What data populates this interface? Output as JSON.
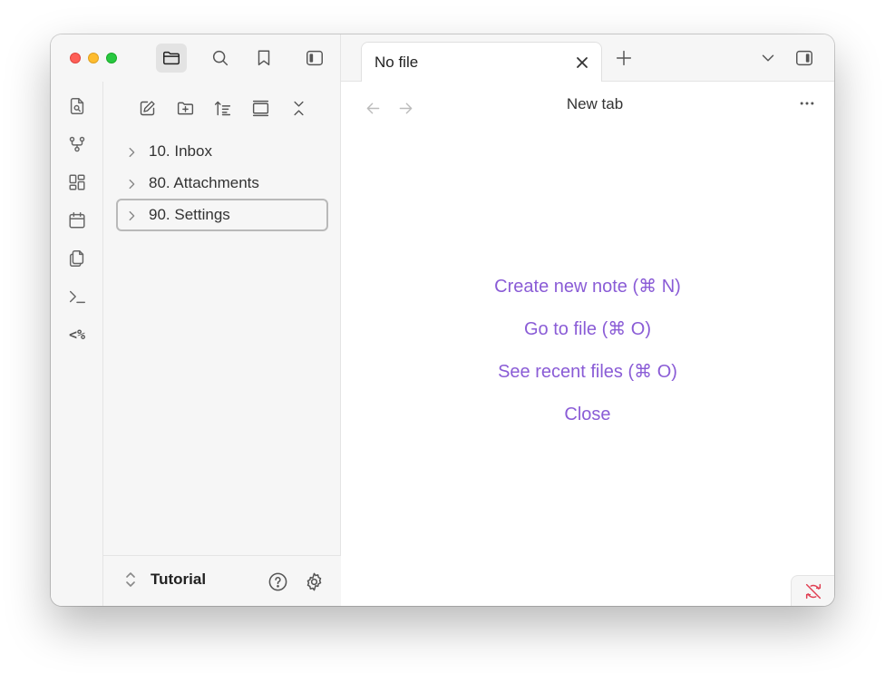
{
  "colors": {
    "accent": "#8a5cd6",
    "sync_error": "#e03e52"
  },
  "titlebar": {
    "controls": [
      "close",
      "minimize",
      "zoom"
    ],
    "toolbar_icons": [
      "folder-icon",
      "search-icon",
      "bookmark-icon",
      "sidebar-toggle-icon"
    ]
  },
  "ribbon": {
    "icons": [
      "file-search-icon",
      "graph-icon",
      "dashboard-icon",
      "calendar-icon",
      "copy-icon",
      "terminal-icon",
      "templater-icon"
    ],
    "templater_label": "<%"
  },
  "file_explorer": {
    "actions": [
      "new-note-icon",
      "new-folder-icon",
      "sort-icon",
      "collapse-view-icon",
      "collapse-all-icon"
    ],
    "items": [
      {
        "label": "10. Inbox"
      },
      {
        "label": "80. Attachments"
      },
      {
        "label": "90. Settings"
      }
    ]
  },
  "vault": {
    "name": "Tutorial"
  },
  "tabs": [
    {
      "title": "No file"
    }
  ],
  "view": {
    "title": "New tab",
    "actions": [
      {
        "label": "Create new note (⌘ N)"
      },
      {
        "label": "Go to file (⌘ O)"
      },
      {
        "label": "See recent files (⌘ O)"
      },
      {
        "label": "Close"
      }
    ]
  }
}
